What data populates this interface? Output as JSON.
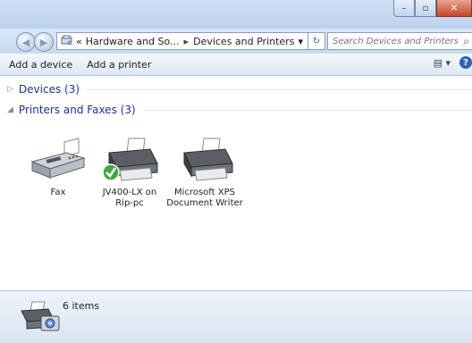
{
  "window": {
    "controls": {
      "minimize": "–",
      "maximize": "▫",
      "close": "✕"
    }
  },
  "address": {
    "overflow": "«",
    "crumbs": [
      "Hardware and So...",
      "Devices and Printers"
    ],
    "separator": "▸",
    "dropdown": "▾",
    "refresh": "↻",
    "search_placeholder": "Search Devices and Printers",
    "search_icon": "⌕"
  },
  "toolbar": {
    "add_device": "Add a device",
    "add_printer": "Add a printer",
    "views_icon": "▤ ▾",
    "help_icon": "?"
  },
  "groups": {
    "devices": {
      "arrow": "▷",
      "label": "Devices (3)"
    },
    "printers": {
      "arrow": "◢",
      "label": "Printers and Faxes (3)"
    }
  },
  "items": [
    {
      "label_line1": "Fax",
      "label_line2": ""
    },
    {
      "label_line1": "JV400-LX on",
      "label_line2": "Rip-pc"
    },
    {
      "label_line1": "Microsoft XPS",
      "label_line2": "Document Writer"
    }
  ],
  "details": {
    "count": "6 items"
  }
}
